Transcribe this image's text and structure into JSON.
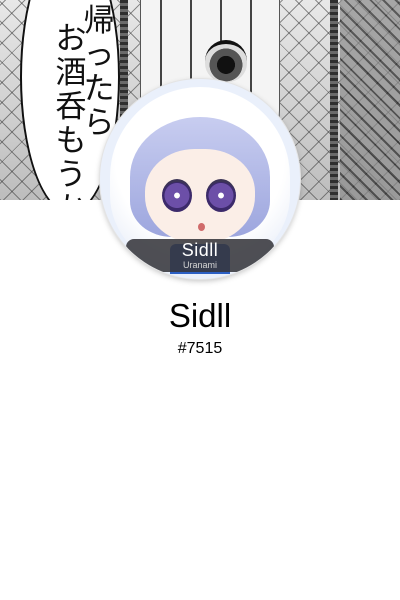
{
  "banner": {
    "speech_text_right": "帰ったら",
    "speech_text_left": "お酒呑もうか"
  },
  "avatar": {
    "nameplate_name": "Sidll",
    "nameplate_sub": "Uranami"
  },
  "profile": {
    "name": "Sidll",
    "tag": "#7515"
  }
}
